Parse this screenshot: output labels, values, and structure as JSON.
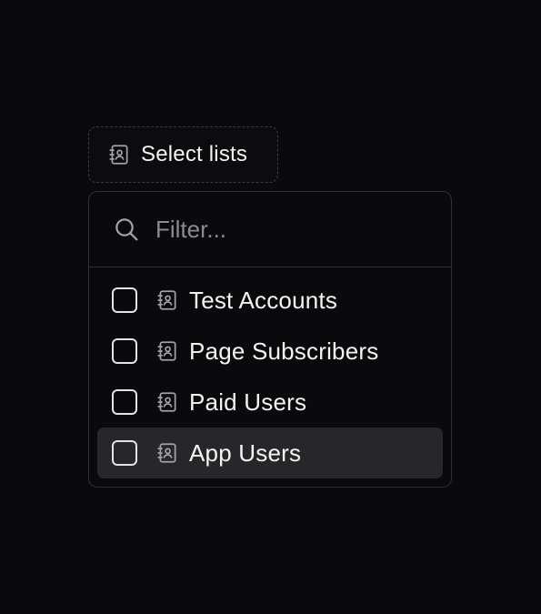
{
  "trigger": {
    "label": "Select lists",
    "icon": "contact-book-icon"
  },
  "filter": {
    "placeholder": "Filter...",
    "value": "",
    "icon": "search-icon"
  },
  "lists": {
    "items": [
      {
        "label": "Test Accounts",
        "checked": false,
        "icon": "contact-book-icon",
        "highlighted": false
      },
      {
        "label": "Page Subscribers",
        "checked": false,
        "icon": "contact-book-icon",
        "highlighted": false
      },
      {
        "label": "Paid Users",
        "checked": false,
        "icon": "contact-book-icon",
        "highlighted": false
      },
      {
        "label": "App Users",
        "checked": false,
        "icon": "contact-book-icon",
        "highlighted": true
      }
    ]
  },
  "colors": {
    "background": "#0a0a0c",
    "border": "#2e2e33",
    "highlight": "#27272a",
    "text": "#f4f4f5",
    "muted": "#a1a1aa"
  }
}
